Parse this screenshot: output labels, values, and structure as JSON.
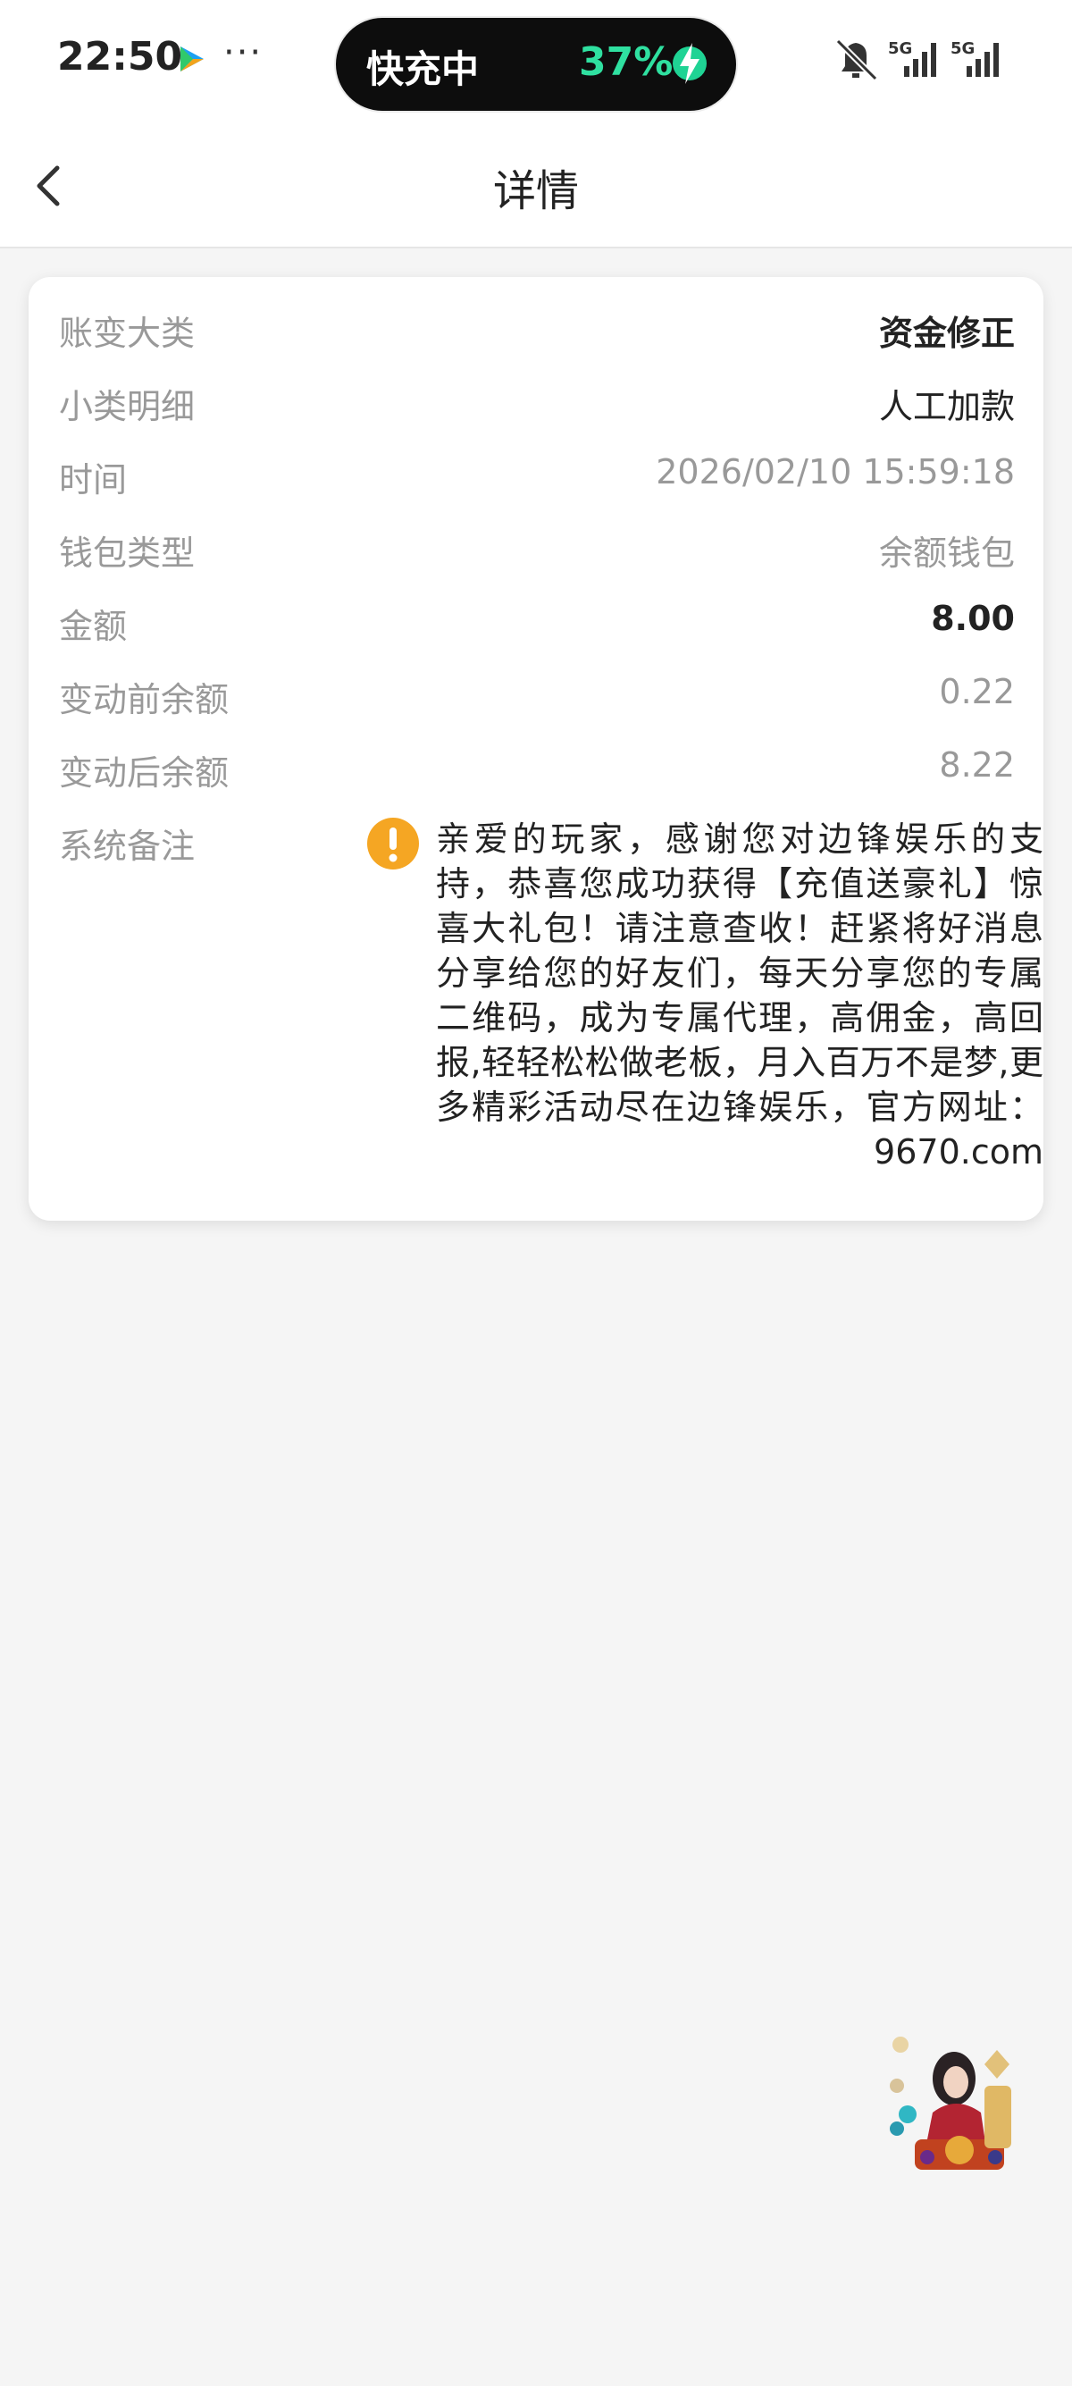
{
  "status_bar": {
    "time": "22:50",
    "charging_label": "快充中",
    "battery_percent": "37%",
    "network_1": "5G",
    "network_2": "5G"
  },
  "header": {
    "title": "详情"
  },
  "details": {
    "rows": [
      {
        "label": "账变大类",
        "value": "资金修正"
      },
      {
        "label": "小类明细",
        "value": "人工加款"
      },
      {
        "label": "时间",
        "value": "2026/02/10 15:59:18"
      },
      {
        "label": "钱包类型",
        "value": "余额钱包"
      },
      {
        "label": "金额",
        "value": "8.00"
      },
      {
        "label": "变动前余额",
        "value": "0.22"
      },
      {
        "label": "变动后余额",
        "value": "8.22"
      }
    ],
    "remark_label": "系统备注",
    "remark_text": "亲爱的玩家，感谢您对边锋娱乐的支持，恭喜您成功获得【充值送豪礼】惊喜大礼包！请注意查收！赶紧将好消息分享给您的好友们，每天分享您的专属二维码，成为专属代理，高佣金，高回报,轻轻松松做老板，月入百万不是梦,更多精彩活动尽在边锋娱乐，官方网址： 9670.com"
  },
  "colors": {
    "accent_warning": "#f5a623",
    "charging_green": "#2fe0a0",
    "label_gray": "#999999",
    "text_dark": "#222222"
  }
}
